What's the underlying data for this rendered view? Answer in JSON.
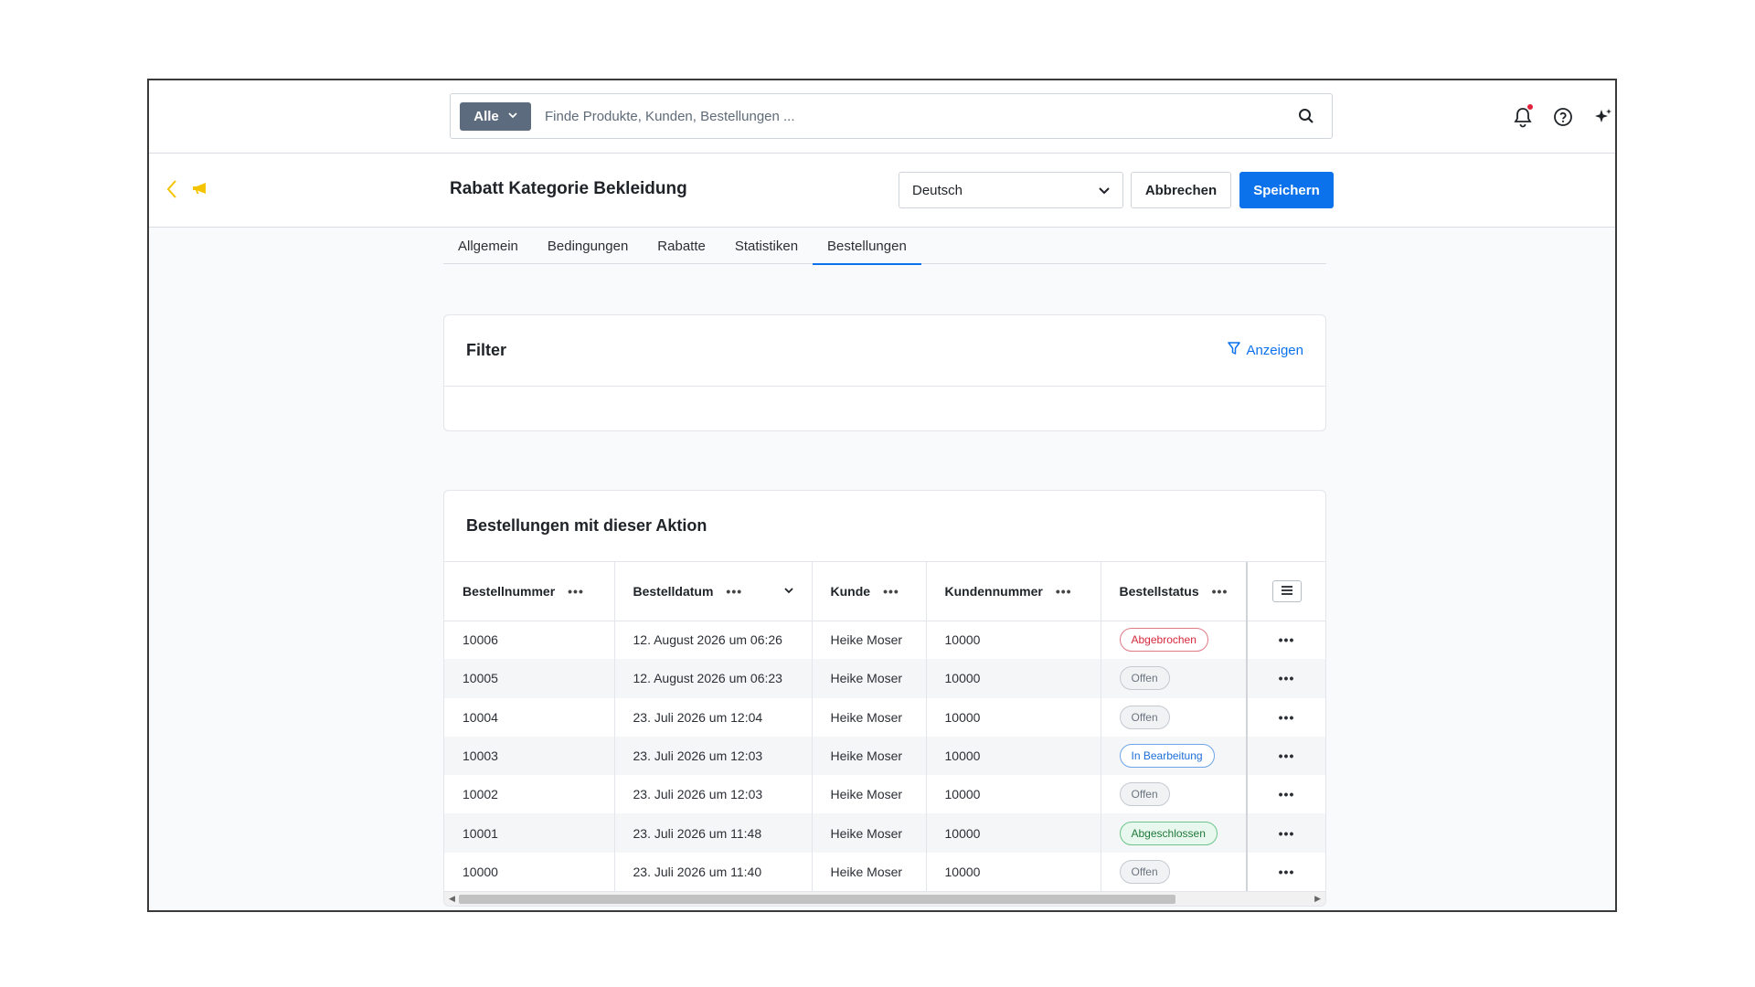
{
  "search": {
    "scope_label": "Alle",
    "placeholder": "Finde Produkte, Kunden, Bestellungen ..."
  },
  "header": {
    "title": "Rabatt Kategorie Bekleidung",
    "language": "Deutsch",
    "cancel_label": "Abbrechen",
    "save_label": "Speichern"
  },
  "tabs": [
    {
      "label": "Allgemein"
    },
    {
      "label": "Bedingungen"
    },
    {
      "label": "Rabatte"
    },
    {
      "label": "Statistiken"
    },
    {
      "label": "Bestellungen",
      "active": true
    }
  ],
  "filter": {
    "title": "Filter",
    "show_label": "Anzeigen"
  },
  "orders": {
    "title": "Bestellungen mit dieser Aktion",
    "columns": [
      "Bestellnummer",
      "Bestelldatum",
      "Kunde",
      "Kundennummer",
      "Bestellstatus"
    ],
    "rows": [
      {
        "number": "10006",
        "date": "12. August 2026 um 06:26",
        "customer": "Heike Moser",
        "customer_no": "10000",
        "status": "Abgebrochen",
        "status_type": "red"
      },
      {
        "number": "10005",
        "date": "12. August 2026 um 06:23",
        "customer": "Heike Moser",
        "customer_no": "10000",
        "status": "Offen",
        "status_type": "grey"
      },
      {
        "number": "10004",
        "date": "23. Juli 2026 um 12:04",
        "customer": "Heike Moser",
        "customer_no": "10000",
        "status": "Offen",
        "status_type": "grey"
      },
      {
        "number": "10003",
        "date": "23. Juli 2026 um 12:03",
        "customer": "Heike Moser",
        "customer_no": "10000",
        "status": "In Bearbeitung",
        "status_type": "blue"
      },
      {
        "number": "10002",
        "date": "23. Juli 2026 um 12:03",
        "customer": "Heike Moser",
        "customer_no": "10000",
        "status": "Offen",
        "status_type": "grey"
      },
      {
        "number": "10001",
        "date": "23. Juli 2026 um 11:48",
        "customer": "Heike Moser",
        "customer_no": "10000",
        "status": "Abgeschlossen",
        "status_type": "green"
      },
      {
        "number": "10000",
        "date": "23. Juli 2026 um 11:40",
        "customer": "Heike Moser",
        "customer_no": "10000",
        "status": "Offen",
        "status_type": "grey"
      }
    ]
  },
  "colors": {
    "primary": "#0b72ec",
    "accent_yellow": "#f5c400",
    "notification_dot": "#e0223a"
  },
  "icons": {
    "search": "search-icon",
    "bell": "bell-icon",
    "help": "help-icon",
    "sparkle": "sparkle-icon",
    "back": "chevron-left-icon",
    "megaphone": "megaphone-icon",
    "filter": "filter-icon"
  }
}
